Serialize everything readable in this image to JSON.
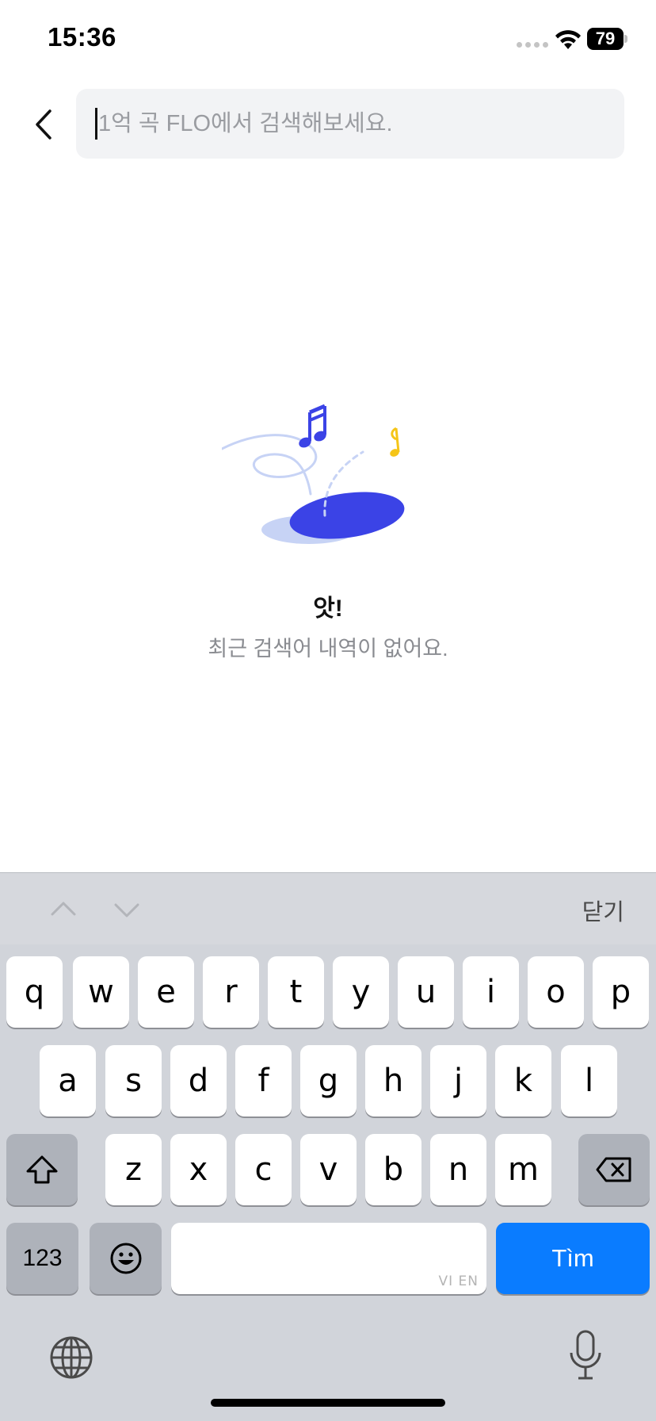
{
  "status_bar": {
    "time": "15:36",
    "battery": "79",
    "icons": [
      "signal-dots-icon",
      "wifi-icon",
      "battery-icon"
    ]
  },
  "search": {
    "back_icon": "chevron-left-icon",
    "placeholder": "1억 곡 FLO에서 검색해보세요.",
    "value": ""
  },
  "empty_state": {
    "illustration": "music-notes-hole-illustration",
    "colors": {
      "primary": "#3b43e6",
      "accent": "#f5c518",
      "light": "#c7d3f5"
    },
    "title": "앗!",
    "message": "최근 검색어 내역이 없어요."
  },
  "keyboard_toolbar": {
    "prev_icon": "chevron-up-icon",
    "next_icon": "chevron-down-icon",
    "close_label": "닫기"
  },
  "keyboard": {
    "row1": [
      "q",
      "w",
      "e",
      "r",
      "t",
      "y",
      "u",
      "i",
      "o",
      "p"
    ],
    "row2": [
      "a",
      "s",
      "d",
      "f",
      "g",
      "h",
      "j",
      "k",
      "l"
    ],
    "row3": [
      "z",
      "x",
      "c",
      "v",
      "b",
      "n",
      "m"
    ],
    "shift_icon": "shift-icon",
    "delete_icon": "backspace-icon",
    "numbers_label": "123",
    "emoji_icon": "emoji-icon",
    "space_lang": "VI EN",
    "return_label": "Tìm",
    "return_color": "#0a7cff",
    "globe_icon": "globe-icon",
    "mic_icon": "microphone-icon"
  }
}
